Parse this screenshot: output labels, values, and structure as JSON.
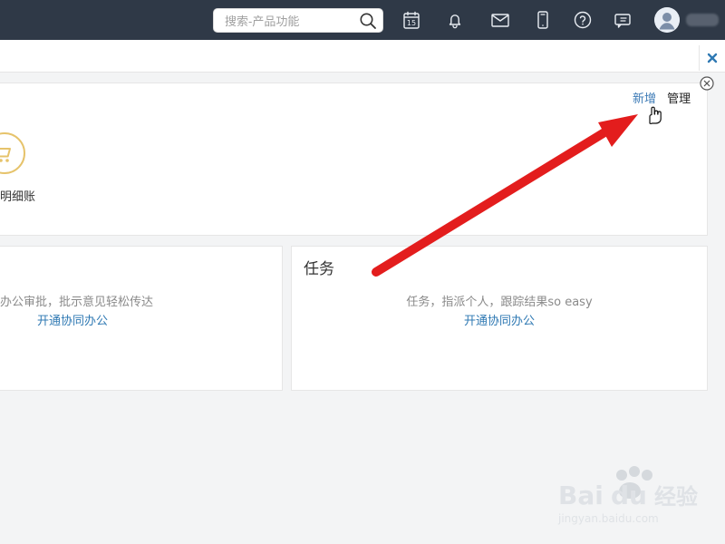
{
  "topbar": {
    "search": {
      "placeholder": "搜索-产品功能",
      "value": ""
    },
    "icons": [
      {
        "name": "calendar-icon",
        "calendar_day": "15"
      },
      {
        "name": "bell-icon"
      },
      {
        "name": "mail-icon"
      },
      {
        "name": "mobile-icon"
      },
      {
        "name": "help-icon"
      },
      {
        "name": "feedback-icon"
      }
    ],
    "colors": {
      "background": "#2f3947",
      "icon": "#e9edf3"
    }
  },
  "main": {
    "top_panel": {
      "actions": {
        "add_label": "新增",
        "manage_label": "管理"
      },
      "shortcut": {
        "label_partial": "明细账",
        "icon": "shopping-cart-icon",
        "accent": "#e6c36b"
      }
    },
    "cards": [
      {
        "title": "",
        "description": "办公审批，批示意见轻松传达",
        "link_label": "开通协同办公"
      },
      {
        "title": "任务",
        "description": "任务，指派个人，跟踪结果so easy",
        "link_label": "开通协同办公"
      }
    ]
  },
  "annotation": {
    "arrow_color": "#e31d1d"
  },
  "watermark": {
    "brand_text": "Baidu经验",
    "domain_text": "jingyan.baidu.com"
  }
}
